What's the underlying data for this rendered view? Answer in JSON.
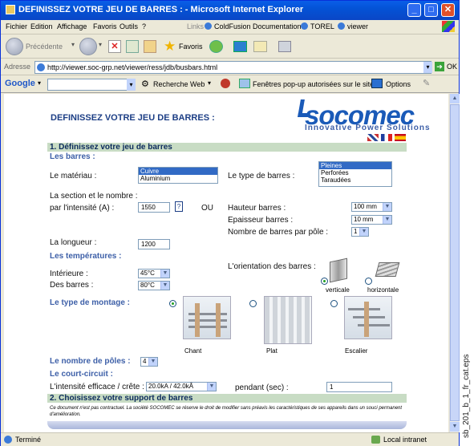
{
  "window": {
    "title": "DEFINISSEZ VOTRE JEU DE BARRES : - Microsoft Internet Explorer"
  },
  "menu": {
    "items": [
      "Fichier",
      "Edition",
      "Affichage",
      "Favoris",
      "Outils",
      "?"
    ],
    "links_label": "Links",
    "links": [
      "ColdFusion Documentation",
      "TOREL",
      "viewer"
    ]
  },
  "toolbar": {
    "back": "Précédente",
    "favorites": "Favoris"
  },
  "address": {
    "label": "Adresse",
    "url": "http://viewer.soc-grp.net/viewer/ress/jdb/busbars.html",
    "go": "OK"
  },
  "google": {
    "brand": "Google",
    "search": "Recherche Web",
    "popups": "Fenêtres pop-up autorisées sur le site",
    "options": "Options"
  },
  "page": {
    "title": "DEFINISSEZ VOTRE JEU DE BARRES :",
    "logo": {
      "name": "socomec",
      "tagline": "Innovative Power Solutions"
    },
    "section1": "1. Définissez votre jeu de barres",
    "barres_heading": "Les barres :",
    "materiau_label": "Le matériau :",
    "materiau_options": [
      "Cuivre",
      "Aluminium"
    ],
    "type_label": "Le type de barres :",
    "type_options": [
      "Pleines",
      "Perforées",
      "Taraudées"
    ],
    "section_label1": "La section et le nombre :",
    "section_label2": "par l'intensité (A) :",
    "intensite": "1550",
    "help": "?",
    "ou": "OU",
    "hauteur_label": "Hauteur barres :",
    "hauteur_value": "100 mm",
    "epaisseur_label": "Epaisseur barres :",
    "epaisseur_value": "10 mm",
    "nombre_label": "Nombre de barres par pôle :",
    "nombre_value": "1",
    "longueur_label": "La longueur :",
    "longueur_value": "1200",
    "temp_heading": "Les températures :",
    "interieure_label": "Intérieure :",
    "interieure_value": "45°C",
    "barres_temp_label": "Des barres :",
    "barres_temp_value": "80°C",
    "orientation_label": "L'orientation des barres :",
    "orientation_options": [
      "verticale",
      "horizontale"
    ],
    "montage_heading": "Le type de montage :",
    "montage_options": [
      "Chant",
      "Plat",
      "Escalier"
    ],
    "poles_heading": "Le nombre de pôles :",
    "poles_value": "4",
    "cc_heading": "Le court-circuit :",
    "cc_label": "L'intensité efficace / crête :",
    "cc_value": "20.0kA / 42.0kÂ",
    "pendant_label": "pendant (sec) :",
    "pendant_value": "1",
    "section2": "2. Choisissez votre support de barres",
    "disclaimer": "Ce document n'est pas contractuel. La société SOCOMEC se réserve le droit de modifier sans préavis les caractéristiques de ses appareils dans un souci permanent d'amélioration."
  },
  "status": {
    "left": "Terminé",
    "right": "Local intranet"
  },
  "side_caption": "sb_201_b_1_fr_cat.eps",
  "colors": {
    "section_bg": "#c8dcc4",
    "heading": "#3e60a8",
    "title_bar": "#0453d6"
  }
}
